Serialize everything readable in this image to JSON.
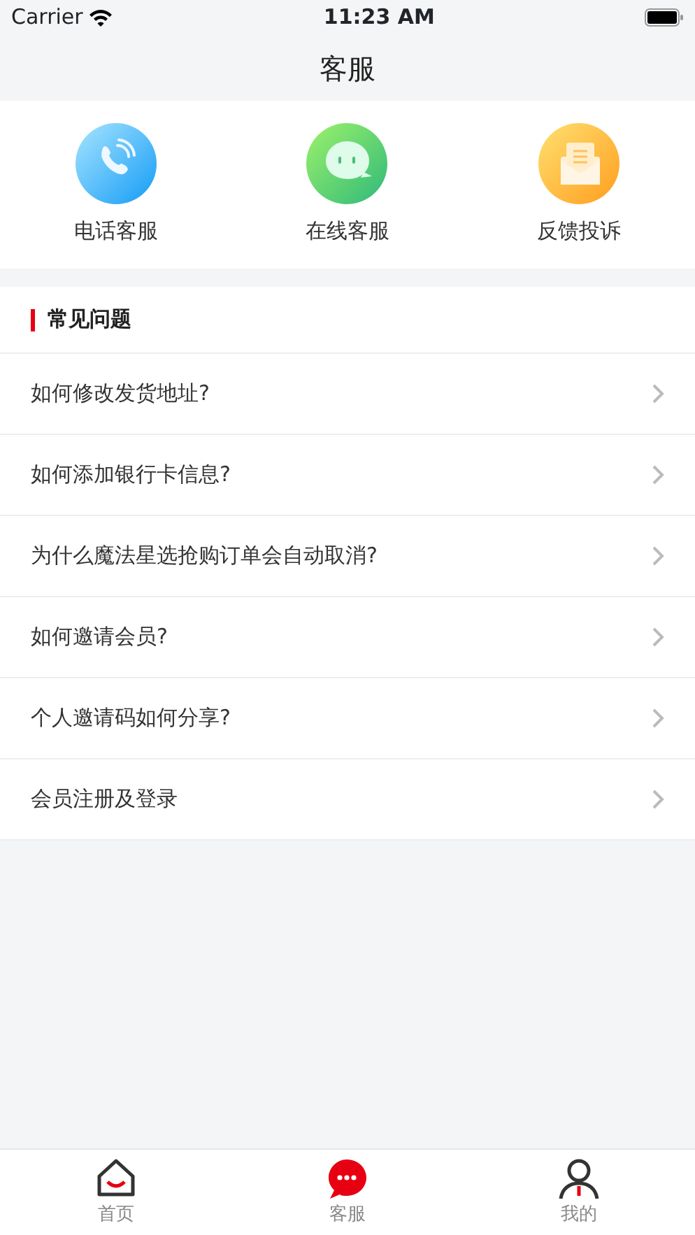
{
  "status_bar": {
    "carrier": "Carrier",
    "time": "11:23 AM"
  },
  "nav": {
    "title": "客服"
  },
  "services": [
    {
      "kind": "phone",
      "label": "电话客服"
    },
    {
      "kind": "chat",
      "label": "在线客服"
    },
    {
      "kind": "feedback",
      "label": "反馈投诉"
    }
  ],
  "faq": {
    "title": "常见问题",
    "items": [
      "如何修改发货地址?",
      "如何添加银行卡信息?",
      "为什么魔法星选抢购订单会自动取消?",
      "如何邀请会员?",
      "个人邀请码如何分享?",
      "会员注册及登录"
    ]
  },
  "tab_bar": [
    {
      "kind": "home",
      "label": "首页",
      "selected": false
    },
    {
      "kind": "service",
      "label": "客服",
      "selected": true
    },
    {
      "kind": "me",
      "label": "我的",
      "selected": false
    }
  ]
}
